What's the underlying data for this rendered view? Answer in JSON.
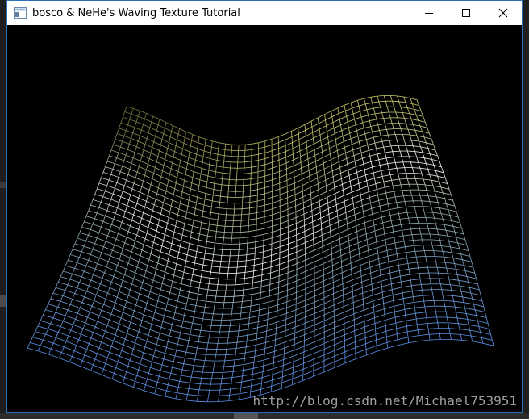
{
  "window": {
    "title": "bosco & NeHe's Waving Texture Tutorial",
    "minimize_label": "",
    "maximize_label": "",
    "close_label": ""
  },
  "scene": {
    "description_color_top": "#c8c86a",
    "description_color_bottom": "#5a8de8",
    "highlight_color": "#ffffff",
    "grid_cols": 44,
    "grid_rows": 44
  },
  "watermark": {
    "text": "http://blog.csdn.net/Michael753951"
  },
  "colors": {
    "title_bar": "#ffffff",
    "window_border": "#2c6fb3",
    "client_bg": "#000000"
  }
}
